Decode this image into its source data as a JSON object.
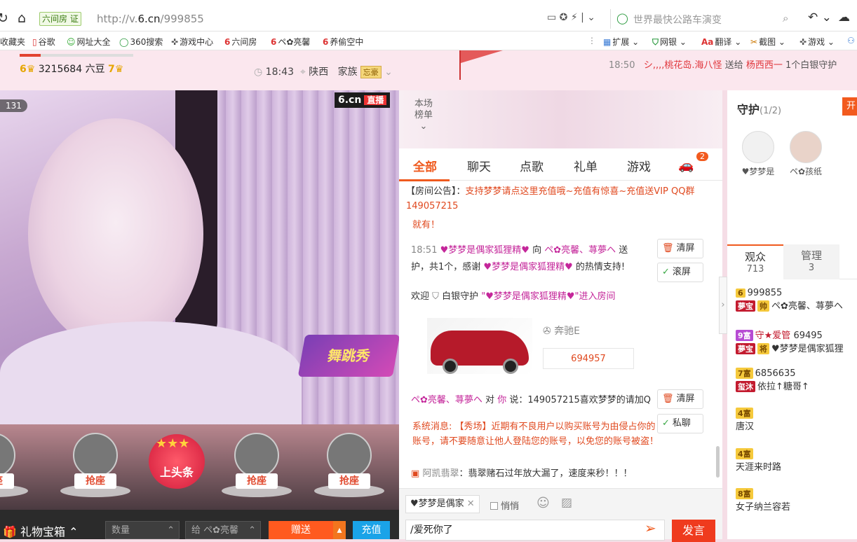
{
  "browser": {
    "site_badge": "六间房 证",
    "url_host_prefix": "http://v.",
    "url_host_bold": "6.cn",
    "url_path": "/999855",
    "search_placeholder": "世界最快公路车演变",
    "bookmarks": [
      "收藏夹",
      "谷歌",
      "网址大全",
      "360搜索",
      "游戏中心",
      "六间房",
      "ペ✿亮馨",
      "养偷空中"
    ],
    "toolbar": [
      "扩展",
      "网银",
      "翻译",
      "截图",
      "游戏"
    ]
  },
  "header": {
    "user_level": "6",
    "user_coins": "3215684 六豆",
    "user_level2": "7",
    "time": "18:43",
    "location": "陕西",
    "family_label": "家族",
    "family_tag": "忘豪",
    "ticker_time": "18:50",
    "ticker_from": "シ,,,,桃花岛.海八怪",
    "ticker_verb": "送给",
    "ticker_to": "杨西西一",
    "ticker_gift": "1个白银守护"
  },
  "video": {
    "viewer_count": "131",
    "logo": "6.cn",
    "live": "直播",
    "dance_badge": "舞跳秀"
  },
  "seats": {
    "grab_label": "抢座",
    "headline": "上头条"
  },
  "bottom": {
    "gift_box": "礼物宝箱",
    "quantity_placeholder": "数量",
    "give_to": "给 ペ✿亮馨",
    "send": "赠送",
    "recharge": "充值"
  },
  "chat": {
    "ranking_line1": "本场",
    "ranking_line2": "榜单",
    "tabs": [
      "全部",
      "聊天",
      "点歌",
      "礼单",
      "游戏"
    ],
    "car_badge": "2",
    "announcement_label": "【房间公告】：",
    "announcement_text": "支持梦梦请点这里充值哦~充值有惊喜~充值送VIP QQ群149057215",
    "announcement_tail": "就有！",
    "gift_time": "18:51",
    "gift_user": "♥梦梦是偶家狐狸精♥",
    "gift_to_word": "向",
    "gift_target": "ペ✿亮馨、荨夢ヘ",
    "gift_send_word": "送",
    "gift_line2_prefix": "护，共1个，感谢",
    "gift_line2_user": "♥梦梦是偶家狐狸精♥",
    "gift_line2_suffix": "的热情支持!",
    "welcome_prefix": "欢迎",
    "welcome_guard": "白银守护",
    "welcome_user": "\"♥梦梦是偶家狐狸精♥\"进入房间",
    "car_name": "奔驰E",
    "car_number": "694957",
    "say_user": "ペ✿亮馨、荨夢ヘ",
    "say_to": "对",
    "say_you": "你",
    "say_text": "说：149057215喜欢梦梦的请加Q",
    "sys_label": "系统消息:",
    "sys_text": "【秀场】近期有不良用户以购买账号为由侵占你的账号，请不要随意让他人登陆您的账号，以免您的账号被盗！",
    "ad_user": "阿凯翡翠",
    "ad_text": "：翡翠赌石过年放大漏了，速度来秒！！！",
    "btn_clear": "清屏",
    "btn_scroll": "滚屏",
    "btn_private": "私聊",
    "to_user": "♥梦梦是偶家",
    "whisper": "悄悄",
    "input_value": "/爱死你了",
    "speak": "发言"
  },
  "right": {
    "guard_title": "守护",
    "guard_count": "(1/2)",
    "guard_open": "开",
    "guards": [
      "♥梦梦是",
      "ペ✿孩纸"
    ],
    "aud_tab": "观众",
    "aud_count": "713",
    "admin_tab": "管理",
    "admin_count": "3",
    "audience": [
      {
        "lvl": "6",
        "name": "999855",
        "tag": "夢宝",
        "tag2": "帅",
        "extra": "ペ✿亮馨、荨夢ヘ"
      },
      {
        "lvl": "9富",
        "name": "69495",
        "tag": "夢宝",
        "tag2": "将",
        "extra": "♥梦梦是偶家狐狸"
      },
      {
        "lvl": "7富",
        "name": "6856635",
        "tag": "玺沐",
        "tag2": "",
        "extra": "依拉↑糖哥↑"
      },
      {
        "lvl": "4富",
        "name": "唐汉",
        "tag": "",
        "tag2": "",
        "extra": ""
      },
      {
        "lvl": "4富",
        "name": "天涯来时路",
        "tag": "",
        "tag2": "",
        "extra": ""
      },
      {
        "lvl": "8富",
        "name": "女子纳兰容若",
        "tag": "",
        "tag2": "",
        "extra": ""
      }
    ]
  }
}
